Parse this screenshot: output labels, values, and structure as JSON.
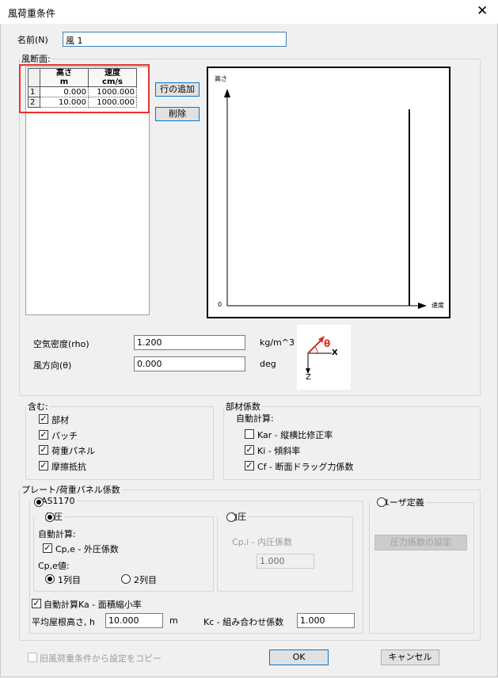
{
  "window": {
    "title": "風荷重条件",
    "close_glyph": "✕"
  },
  "name": {
    "label": "名前(N)",
    "value": "風 1"
  },
  "section": {
    "label": "風断面:",
    "table": {
      "headers": [
        {
          "top": "高さ",
          "unit": "m"
        },
        {
          "top": "速度",
          "unit": "cm/s"
        }
      ],
      "rows": [
        {
          "index": "1",
          "height": "0.000",
          "speed": "1000.000"
        },
        {
          "index": "2",
          "height": "10.000",
          "speed": "1000.000"
        }
      ]
    },
    "add_row_button": "行の追加",
    "delete_button": "削除",
    "plot": {
      "y_label": "高さ",
      "x_label": "速度",
      "origin_label": "0"
    },
    "air_density": {
      "label": "空気密度(rho)",
      "value": "1.200",
      "unit": "kg/m^3"
    },
    "wind_direction": {
      "label": "風方向(θ)",
      "value": "0.000",
      "unit": "deg"
    },
    "diagram": {
      "theta": "θ",
      "x": "X",
      "z": "Z"
    }
  },
  "include": {
    "label": "含む:",
    "items": [
      {
        "label": "部材",
        "checked": true
      },
      {
        "label": "パッチ",
        "checked": true
      },
      {
        "label": "荷重パネル",
        "checked": true
      },
      {
        "label": "摩擦抵抗",
        "checked": true
      }
    ]
  },
  "member_coefficients": {
    "label": "部材係数",
    "auto_calc_label": "自動計算:",
    "items": [
      {
        "label": "Kar - 縦横比修正率",
        "checked": false
      },
      {
        "label": "Ki - 傾斜率",
        "checked": true
      },
      {
        "label": "Cf - 断面ドラッグ力係数",
        "checked": true
      }
    ]
  },
  "plate": {
    "label": "プレート/荷重パネル係数",
    "as1170_label": "AS1170",
    "user_defined_label": "ユーザ定義",
    "pressure_button": "圧力係数の設定",
    "external": {
      "label": "外圧",
      "auto_calc_label": "自動計算:",
      "cpe_check_label": "Cp,e - 外圧係数",
      "cpe_values_label": "Cp,e値:",
      "col1_label": "1列目",
      "col2_label": "2列目"
    },
    "internal": {
      "label": "内圧",
      "cpi_label": "Cp,i - 内圧係数",
      "cpi_value": "1.000"
    },
    "ka_check_label": "自動計算Ka - 面積縮小率",
    "mean_roof_height": {
      "label": "平均屋根高さ, h",
      "value": "10.000",
      "unit": "m"
    },
    "kc": {
      "label": "Kc - 組み合わせ係数",
      "value": "1.000"
    }
  },
  "footer": {
    "copy_label": "旧風荷重条件から設定をコピー",
    "ok": "OK",
    "cancel": "キャンセル"
  },
  "colors": {
    "highlight": "#e8322b",
    "accent": "#0078d7",
    "arrow": "#d9301f"
  }
}
